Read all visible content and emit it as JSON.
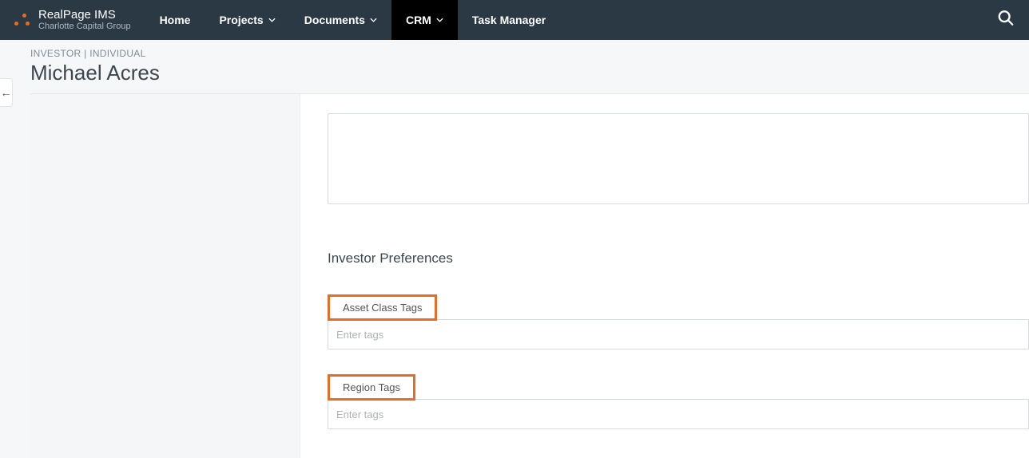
{
  "brand": {
    "title": "RealPage IMS",
    "subtitle": "Charlotte Capital Group"
  },
  "nav": {
    "home": "Home",
    "projects": "Projects",
    "documents": "Documents",
    "crm": "CRM",
    "task_manager": "Task Manager"
  },
  "breadcrumb": "INVESTOR | INDIVIDUAL",
  "page_title": "Michael Acres",
  "section": {
    "heading": "Investor Preferences",
    "asset_class": {
      "label": "Asset Class Tags",
      "placeholder": "Enter tags"
    },
    "region": {
      "label": "Region Tags",
      "placeholder": "Enter tags"
    }
  },
  "icons": {
    "back": "←"
  }
}
